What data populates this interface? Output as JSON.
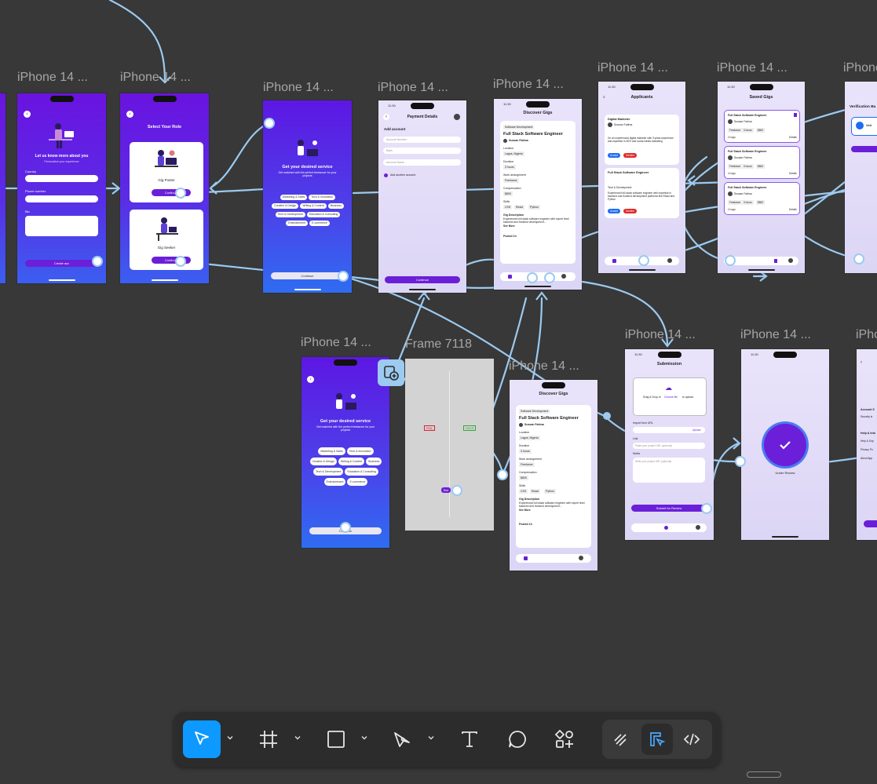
{
  "canvas": {
    "background": "#383838",
    "frames": {
      "f1": "iPhone 14 ...",
      "f2": "iPhone 14 ...",
      "f3": "iPhone 14 ...",
      "f4": "iPhone 14 ...",
      "f5": "iPhone 14 ...",
      "f6": "iPhone 14 ...",
      "f7": "iPhone 14 ...",
      "f8": "iPhone 14 ...",
      "f9": "iPhone 14 ...",
      "f10": "iPhone 14 ...",
      "f11": "Frame 7118",
      "f12": "iPhone 14 ...",
      "f13": "iPhone 14 ...",
      "f14": "iPhone 14 ...",
      "f15": "iPhone 14 ...",
      "f16": "iPhone 14 ...",
      "f17": "iPhone 14 ..."
    }
  },
  "screens": {
    "about": {
      "title": "Let us know more about you",
      "subtitle": "Personalize your experience",
      "country": "Country",
      "phone": "Phone number",
      "bio": "Bio",
      "button": "Create acc"
    },
    "role": {
      "title": "Select Your Role",
      "poster": "Gig Poster",
      "seeker": "Gig Seeker",
      "continue": "Continue"
    },
    "service": {
      "title": "Get your desired service",
      "subtitle": "Get matched with the perfect freelancer for your projects",
      "chips": [
        "Marketing & Sales",
        "Tech & Innovation",
        "Creative & Design",
        "Writing & Content",
        "Business",
        "Tech & Development",
        "Education & Consulting",
        "Entertainment",
        "E-commerce"
      ],
      "continue": "Continue"
    },
    "payment": {
      "time": "11:30",
      "title": "Payment Details",
      "add": "Add account",
      "f1": "Account Number",
      "f2": "Bank",
      "f3": "Account Name",
      "default": "Add another account",
      "continue": "Continue"
    },
    "discover": {
      "time": "11:30",
      "title": "Discover Gigs",
      "category": "Software Development",
      "job": "Full Stack Software Engineer",
      "poster": "Sussan Fatima",
      "location_label": "Location",
      "location": "Lagos, Nigeria",
      "duration_label": "Duration",
      "duration": "3 hours",
      "work_label": "Work arrangement",
      "work": "Freelance",
      "comp_label": "Compensation",
      "comp": "$800",
      "skills_label": "Skills",
      "skills": [
        "CSS",
        "React",
        "Python"
      ],
      "desc_label": "Gig Description",
      "desc": "Experienced full stack software engineer with expert level backend and frontend development...",
      "see_more": "See More",
      "posted": "Posted 1h"
    },
    "applicants": {
      "time": "11:30",
      "title": "Applicants",
      "c1_title": "Digital Marketer",
      "c1_name": "Sussan Fatima",
      "c1_text": "I'm an experienced digital marketer with 3 years experience and expertise in SEO and social media marketing",
      "accept": "Accept",
      "decline": "Decline",
      "c2_title": "Full Stack Software Engineer",
      "c2_sub": "Tech & Development",
      "c2_text": "Experienced full stack software engineer with expertise in backend and frontend development platforms like React and Python"
    },
    "saved": {
      "time": "11:30",
      "title": "Saved Gigs",
      "job": "Full Stack Software Engineer",
      "name": "Sussan Fatima",
      "tags": [
        "Freelance",
        "3 hours",
        "$800"
      ],
      "posted": "1h ago",
      "details": "Details"
    },
    "verification": {
      "title": "Verification Ba",
      "item": "Veri"
    },
    "submission": {
      "time": "11:30",
      "title": "Submission",
      "upload": "Drag & Drop or",
      "choose": "Choose file",
      "to_upload": "to upload",
      "import": "Import from URL",
      "upload_link": "Upload",
      "link": "Link",
      "link_ph": "Paste your project URL (optional)",
      "notes": "Notes",
      "notes_ph": "Write your project URL (optional)",
      "submit": "Submit for Review"
    },
    "review": {
      "time": "11:30",
      "text": "Under Review"
    },
    "security": {
      "t1": "Account S",
      "t2": "Security is",
      "t3": "Help & Info",
      "t4": "Help & Sup",
      "t5": "Privacy Po",
      "t6": "About App"
    },
    "frame7118": {
      "fail": "FAIL",
      "pass": "PASS",
      "bot": "Bot"
    }
  },
  "toolbar": {
    "tools": [
      "move-tool",
      "frame-tool",
      "rectangle-tool",
      "pen-tool",
      "text-tool",
      "comment-tool",
      "actions-tool"
    ],
    "modes": [
      "draw-mode",
      "design-mode",
      "dev-mode"
    ],
    "accent": "#0d99ff"
  }
}
